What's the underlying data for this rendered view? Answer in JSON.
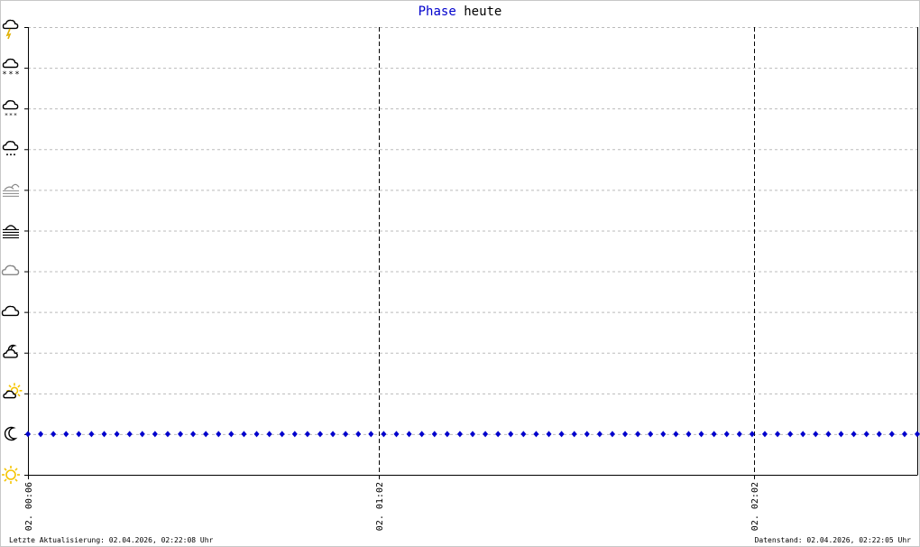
{
  "title": {
    "blue": "Phase",
    "black": "heute"
  },
  "footer": {
    "left": "Letzte Aktualisierung: 02.04.2026, 02:22:08 Uhr",
    "right": "Datenstand: 02.04.2026, 02:22:05 Uhr"
  },
  "colors": {
    "series": "#0000cc",
    "sun": "#f5c400",
    "lightning": "#e0b000",
    "icon_dark": "#000000",
    "icon_grey": "#888888"
  },
  "chart_data": {
    "type": "scatter",
    "title": "Phase heute",
    "y_levels": [
      "sun-icon",
      "moon-icon",
      "partly-cloudy-day-icon",
      "partly-cloudy-night-icon",
      "cloud-icon",
      "overcast-icon",
      "fog-icon",
      "haze-icon",
      "rain-icon",
      "sleet-icon",
      "snow-icon",
      "thunderstorm-icon"
    ],
    "ylim": [
      0,
      11
    ],
    "x_ticks": [
      {
        "label": "02. 00:06",
        "minute": 6
      },
      {
        "label": "02. 01:02",
        "minute": 62
      },
      {
        "label": "02. 02:02",
        "minute": 122
      }
    ],
    "xlim": [
      6,
      148
    ],
    "vertical_markers_minutes": [
      62,
      122
    ],
    "series": [
      {
        "level": 1,
        "x_start_minute": 6,
        "x_end_minute": 148,
        "points": 71
      }
    ],
    "grid": true
  }
}
